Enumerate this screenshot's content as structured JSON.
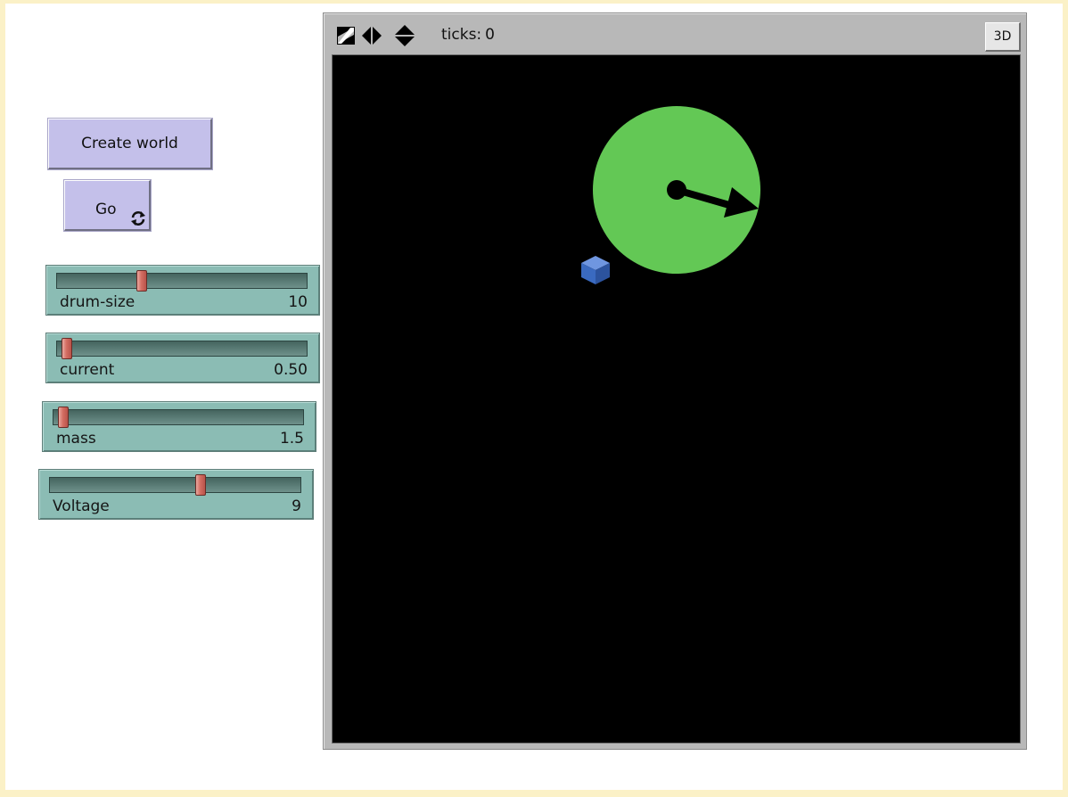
{
  "buttons": {
    "create_world": "Create world",
    "go": "Go",
    "go_forever_icon": "forever-arrows-icon"
  },
  "sliders": [
    {
      "name": "drum-size",
      "value": "10",
      "fraction": 0.34
    },
    {
      "name": "current",
      "value": "0.50",
      "fraction": 0.04
    },
    {
      "name": "mass",
      "value": "1.5",
      "fraction": 0.04
    },
    {
      "name": "Voltage",
      "value": "9",
      "fraction": 0.6
    }
  ],
  "view": {
    "ticks_label": "ticks:",
    "ticks_value": "0",
    "button_3d": "3D",
    "toolbar_icons": [
      "wrap-diagonal-icon",
      "wrap-horizontal-icon",
      "wrap-vertical-icon"
    ]
  },
  "world_agents": {
    "drum_color": "#63c855",
    "block_color": "#3a6ac0",
    "arrow_color": "#000000",
    "background": "#000000"
  }
}
